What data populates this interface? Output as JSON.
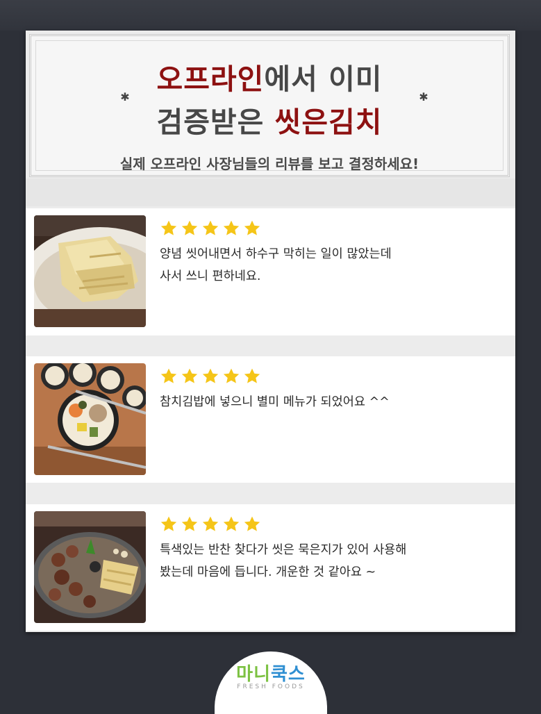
{
  "header": {
    "title_line1_red": "오프라인",
    "title_line1_rest": "에서 이미",
    "title_line2_dark": "검증받은 ",
    "title_line2_red": "씻은김치",
    "subtitle": "실제 오프라인 사장님들의 리뷰를 보고 결정하세요!"
  },
  "reviews": [
    {
      "rating": 5,
      "text_line1": "양념 씻어내면서 하수구 막히는 일이 많았는데",
      "text_line2": "사서 쓰니 편하네요.",
      "photo": "washed-kimchi-plate"
    },
    {
      "rating": 5,
      "text_line1": "참치김밥에 넣으니 별미 메뉴가 되었어요 ^^",
      "text_line2": "",
      "photo": "tuna-kimbap"
    },
    {
      "rating": 5,
      "text_line1": "특색있는 반찬 찾다가 씻은 묵은지가 있어 사용해",
      "text_line2": "봤는데 마음에 듭니다. 개운한 것 같아요 ~",
      "photo": "grilled-pork-with-kimchi"
    }
  ],
  "logo": {
    "part1": "마니",
    "part2": "쿡스",
    "tagline": "FRESH FOODS"
  },
  "colors": {
    "accent_red": "#8d1111",
    "star": "#f5c518",
    "background": "#2d3038",
    "logo_green": "#7cc142",
    "logo_blue": "#2f8fd2"
  }
}
